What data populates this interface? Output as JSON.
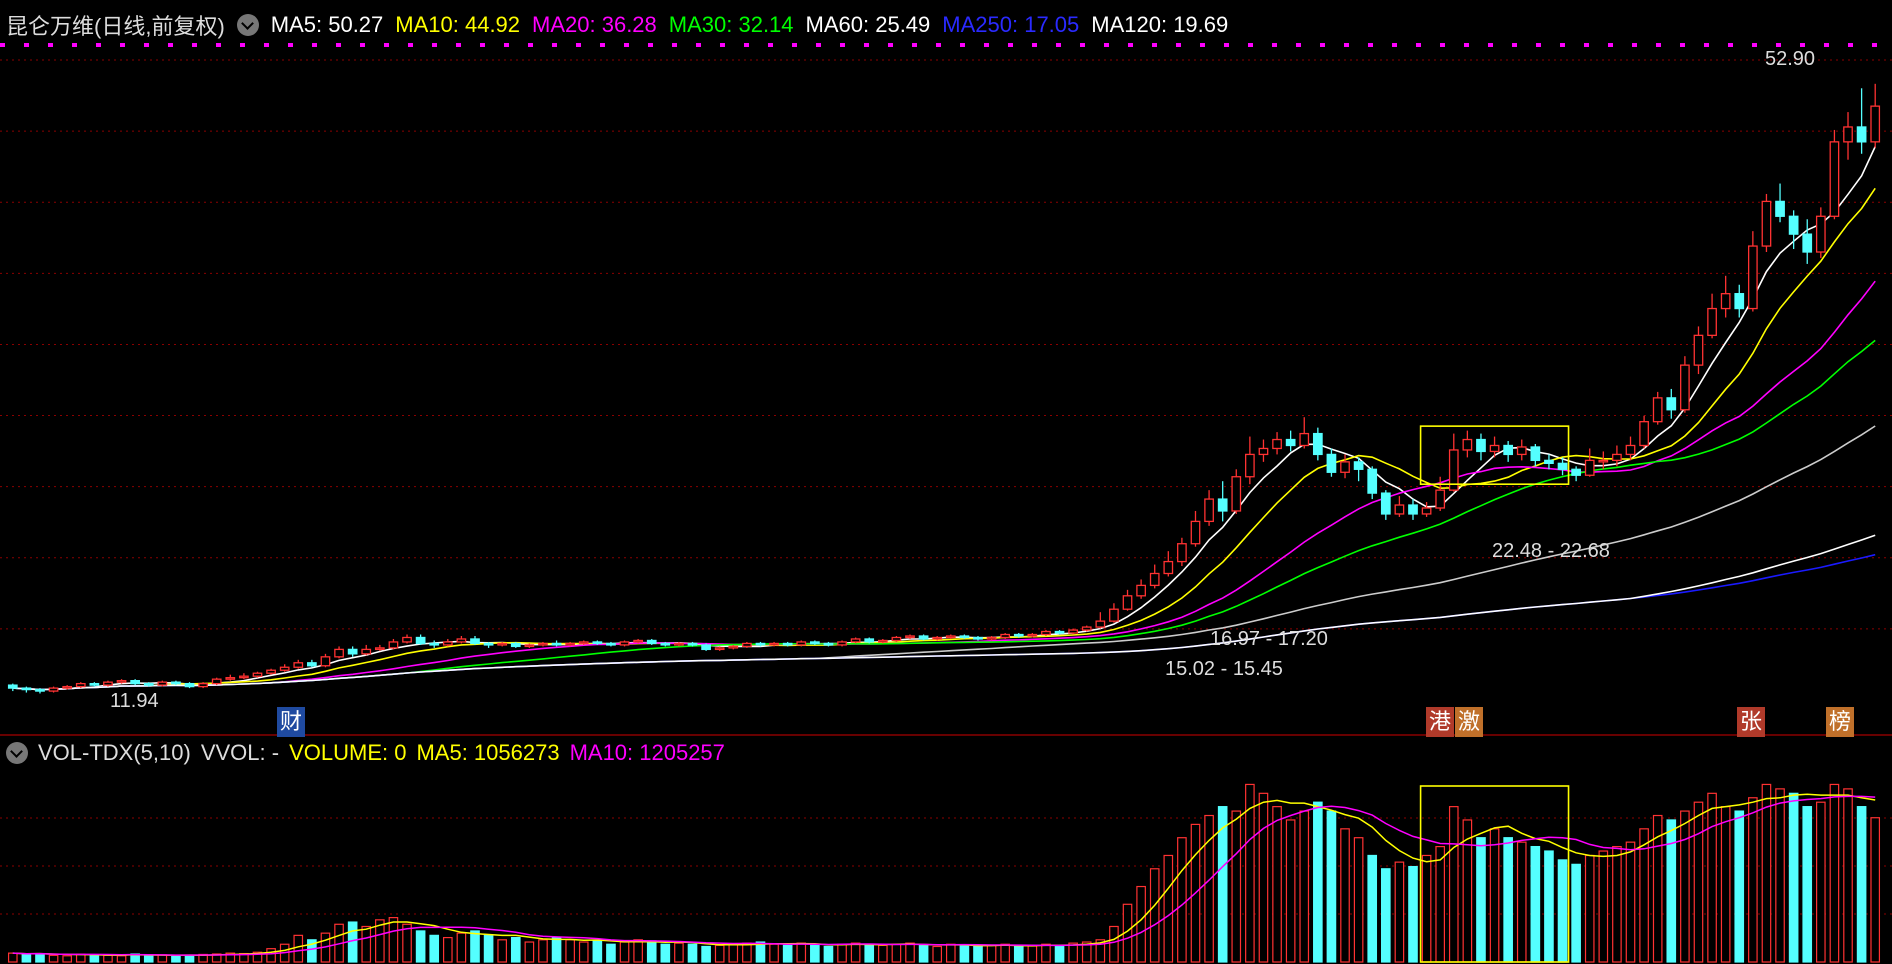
{
  "header": {
    "stock_name": "昆仑万维(日线,前复权)",
    "ma": [
      {
        "label": "MA5: 50.27",
        "color": "#ffffff"
      },
      {
        "label": "MA10: 44.92",
        "color": "#ffff00"
      },
      {
        "label": "MA20: 36.28",
        "color": "#ff00ff"
      },
      {
        "label": "MA30: 32.14",
        "color": "#00ff00"
      },
      {
        "label": "MA60: 25.49",
        "color": "#ffffff"
      },
      {
        "label": "MA250: 17.05",
        "color": "#2020ff"
      },
      {
        "label": "MA120: 19.69",
        "color": "#ffffff"
      }
    ]
  },
  "volume_header": {
    "indicator": "VOL-TDX(5,10)",
    "vvol": "VVOL: -",
    "volume": "VOLUME: 0",
    "ma5": "MA5: 1056273",
    "ma10": "MA10: 1205257"
  },
  "price_labels": {
    "high": "52.90",
    "low": "11.94",
    "range1": "16.97 - 17.20",
    "range2": "15.02 - 15.45",
    "range3": "22.48 - 22.68"
  },
  "events": [
    {
      "label": "财",
      "color": "#1f4aa0"
    },
    {
      "label": "港",
      "color": "#b03a2a"
    },
    {
      "label": "激",
      "color": "#c0702a"
    },
    {
      "label": "张",
      "color": "#b03a2a"
    },
    {
      "label": "榜",
      "color": "#c0702a"
    }
  ],
  "colors": {
    "up": "#ff3232",
    "down": "#54ffff",
    "background": "#000000",
    "grid": "#8b0000",
    "box": "#ffff00"
  },
  "chart_data": {
    "type": "candlestick",
    "title": "昆仑万维(日线,前复权)",
    "ylim": [
      11.5,
      54.5
    ],
    "candles": [
      [
        12.5,
        12.3,
        12.6,
        12.1
      ],
      [
        12.3,
        12.2,
        12.4,
        12.0
      ],
      [
        12.2,
        12.1,
        12.3,
        11.94
      ],
      [
        12.1,
        12.3,
        12.4,
        12.0
      ],
      [
        12.3,
        12.4,
        12.5,
        12.2
      ],
      [
        12.4,
        12.6,
        12.7,
        12.3
      ],
      [
        12.6,
        12.5,
        12.7,
        12.4
      ],
      [
        12.5,
        12.7,
        12.8,
        12.4
      ],
      [
        12.7,
        12.8,
        12.9,
        12.6
      ],
      [
        12.8,
        12.6,
        12.9,
        12.5
      ],
      [
        12.6,
        12.5,
        12.7,
        12.4
      ],
      [
        12.5,
        12.7,
        12.8,
        12.4
      ],
      [
        12.7,
        12.6,
        12.8,
        12.5
      ],
      [
        12.6,
        12.4,
        12.7,
        12.3
      ],
      [
        12.4,
        12.6,
        12.7,
        12.3
      ],
      [
        12.6,
        12.9,
        13.0,
        12.5
      ],
      [
        12.9,
        13.0,
        13.2,
        12.8
      ],
      [
        13.0,
        13.1,
        13.3,
        12.9
      ],
      [
        13.1,
        13.3,
        13.4,
        13.0
      ],
      [
        13.3,
        13.5,
        13.6,
        13.2
      ],
      [
        13.5,
        13.7,
        13.9,
        13.4
      ],
      [
        13.7,
        14.0,
        14.2,
        13.6
      ],
      [
        14.0,
        13.8,
        14.2,
        13.7
      ],
      [
        13.8,
        14.4,
        14.6,
        13.7
      ],
      [
        14.4,
        14.9,
        15.1,
        14.3
      ],
      [
        14.9,
        14.6,
        15.1,
        14.4
      ],
      [
        14.6,
        14.9,
        15.2,
        14.5
      ],
      [
        14.9,
        15.0,
        15.2,
        14.8
      ],
      [
        15.0,
        15.4,
        15.6,
        14.9
      ],
      [
        15.4,
        15.7,
        15.9,
        15.3
      ],
      [
        15.7,
        15.3,
        15.9,
        15.2
      ],
      [
        15.3,
        15.2,
        15.5,
        15.0
      ],
      [
        15.2,
        15.4,
        15.6,
        15.1
      ],
      [
        15.4,
        15.6,
        15.8,
        15.3
      ],
      [
        15.6,
        15.3,
        15.8,
        15.2
      ],
      [
        15.3,
        15.2,
        15.4,
        15.0
      ],
      [
        15.2,
        15.3,
        15.4,
        15.1
      ],
      [
        15.3,
        15.1,
        15.4,
        15.0
      ],
      [
        15.1,
        15.2,
        15.3,
        15.0
      ],
      [
        15.2,
        15.3,
        15.4,
        15.1
      ],
      [
        15.3,
        15.2,
        15.5,
        15.1
      ],
      [
        15.2,
        15.3,
        15.4,
        15.1
      ],
      [
        15.3,
        15.4,
        15.5,
        15.2
      ],
      [
        15.4,
        15.3,
        15.5,
        15.2
      ],
      [
        15.3,
        15.2,
        15.4,
        15.1
      ],
      [
        15.2,
        15.4,
        15.5,
        15.1
      ],
      [
        15.4,
        15.5,
        15.6,
        15.3
      ],
      [
        15.5,
        15.3,
        15.6,
        15.2
      ],
      [
        15.3,
        15.2,
        15.4,
        15.1
      ],
      [
        15.2,
        15.3,
        15.4,
        15.1
      ],
      [
        15.3,
        15.2,
        15.4,
        15.1
      ],
      [
        15.2,
        14.9,
        15.3,
        14.8
      ],
      [
        14.9,
        15.0,
        15.1,
        14.8
      ],
      [
        15.0,
        15.1,
        15.2,
        14.9
      ],
      [
        15.1,
        15.3,
        15.4,
        15.0
      ],
      [
        15.3,
        15.2,
        15.4,
        15.1
      ],
      [
        15.2,
        15.3,
        15.4,
        15.1
      ],
      [
        15.3,
        15.2,
        15.4,
        15.1
      ],
      [
        15.2,
        15.4,
        15.5,
        15.1
      ],
      [
        15.4,
        15.3,
        15.5,
        15.2
      ],
      [
        15.3,
        15.2,
        15.4,
        15.1
      ],
      [
        15.2,
        15.4,
        15.5,
        15.1
      ],
      [
        15.4,
        15.6,
        15.7,
        15.3
      ],
      [
        15.6,
        15.4,
        15.7,
        15.3
      ],
      [
        15.4,
        15.5,
        15.6,
        15.3
      ],
      [
        15.5,
        15.7,
        15.8,
        15.4
      ],
      [
        15.7,
        15.8,
        15.9,
        15.6
      ],
      [
        15.8,
        15.6,
        15.9,
        15.5
      ],
      [
        15.6,
        15.7,
        15.8,
        15.5
      ],
      [
        15.7,
        15.8,
        15.9,
        15.6
      ],
      [
        15.8,
        15.7,
        15.9,
        15.6
      ],
      [
        15.7,
        15.6,
        15.8,
        15.5
      ],
      [
        15.6,
        15.7,
        15.8,
        15.5
      ],
      [
        15.7,
        15.9,
        16.0,
        15.6
      ],
      [
        15.9,
        15.8,
        16.0,
        15.7
      ],
      [
        15.8,
        15.9,
        16.0,
        15.7
      ],
      [
        15.9,
        16.1,
        16.2,
        15.8
      ],
      [
        16.1,
        16.0,
        16.2,
        15.9
      ],
      [
        16.0,
        16.2,
        16.3,
        15.9
      ],
      [
        16.2,
        16.4,
        16.5,
        16.1
      ],
      [
        16.4,
        16.8,
        17.4,
        16.3
      ],
      [
        16.8,
        17.6,
        18.0,
        16.7
      ],
      [
        17.6,
        18.5,
        18.9,
        17.5
      ],
      [
        18.5,
        19.2,
        19.6,
        18.3
      ],
      [
        19.2,
        20.0,
        20.6,
        19.0
      ],
      [
        20.0,
        20.8,
        21.5,
        19.8
      ],
      [
        20.8,
        22.0,
        22.4,
        20.5
      ],
      [
        22.0,
        23.5,
        24.2,
        21.8
      ],
      [
        23.5,
        25.0,
        25.6,
        23.2
      ],
      [
        25.0,
        24.2,
        26.2,
        23.5
      ],
      [
        24.2,
        26.5,
        27.0,
        24.0
      ],
      [
        26.5,
        28.0,
        29.2,
        26.0
      ],
      [
        28.0,
        28.4,
        29.0,
        27.5
      ],
      [
        28.4,
        29.0,
        29.5,
        28.0
      ],
      [
        29.0,
        28.6,
        29.6,
        28.2
      ],
      [
        28.6,
        29.4,
        30.5,
        28.4
      ],
      [
        29.4,
        28.0,
        29.8,
        27.6
      ],
      [
        28.0,
        26.8,
        28.4,
        26.5
      ],
      [
        26.8,
        27.5,
        28.0,
        26.4
      ],
      [
        27.5,
        27.0,
        27.8,
        26.2
      ],
      [
        27.0,
        25.4,
        27.2,
        25.0
      ],
      [
        25.4,
        24.0,
        25.6,
        23.6
      ],
      [
        24.0,
        24.6,
        25.2,
        23.8
      ],
      [
        24.6,
        24.0,
        25.0,
        23.6
      ],
      [
        24.0,
        24.4,
        24.8,
        23.8
      ],
      [
        24.4,
        25.6,
        26.5,
        24.2
      ],
      [
        25.6,
        28.3,
        29.4,
        25.5
      ],
      [
        28.3,
        29.0,
        29.6,
        27.8
      ],
      [
        29.0,
        28.2,
        29.4,
        27.6
      ],
      [
        28.2,
        28.6,
        29.2,
        27.8
      ],
      [
        28.6,
        28.0,
        28.9,
        27.5
      ],
      [
        28.0,
        28.5,
        29.0,
        27.6
      ],
      [
        28.5,
        27.6,
        28.7,
        27.2
      ],
      [
        27.6,
        27.4,
        28.0,
        27.0
      ],
      [
        27.4,
        27.0,
        27.8,
        26.6
      ],
      [
        27.0,
        26.6,
        27.2,
        26.2
      ],
      [
        26.6,
        27.6,
        28.4,
        26.5
      ],
      [
        27.6,
        27.6,
        28.2,
        27.0
      ],
      [
        27.6,
        28.0,
        28.6,
        27.2
      ],
      [
        28.0,
        28.6,
        29.2,
        27.6
      ],
      [
        28.6,
        30.2,
        30.6,
        28.4
      ],
      [
        30.2,
        31.8,
        32.2,
        30.0
      ],
      [
        31.8,
        31.0,
        32.4,
        30.4
      ],
      [
        31.0,
        34.0,
        34.6,
        30.8
      ],
      [
        34.0,
        36.0,
        36.6,
        33.4
      ],
      [
        36.0,
        37.8,
        38.8,
        35.8
      ],
      [
        37.8,
        38.8,
        40.0,
        37.2
      ],
      [
        38.8,
        37.8,
        39.4,
        37.2
      ],
      [
        37.8,
        42.0,
        43.0,
        37.6
      ],
      [
        42.0,
        45.0,
        45.5,
        41.6
      ],
      [
        45.0,
        44.0,
        46.2,
        43.6
      ],
      [
        44.0,
        42.8,
        44.4,
        41.8
      ],
      [
        42.8,
        41.6,
        43.8,
        40.8
      ],
      [
        41.6,
        44.0,
        44.6,
        41.2
      ],
      [
        44.0,
        49.0,
        49.8,
        43.8
      ],
      [
        49.0,
        50.0,
        51.0,
        47.8
      ],
      [
        50.0,
        49.0,
        52.6,
        48.2
      ],
      [
        49.0,
        51.4,
        52.9,
        48.6
      ]
    ],
    "volumes_k": [
      [
        40,
        0
      ],
      [
        35,
        1
      ],
      [
        38,
        1
      ],
      [
        30,
        0
      ],
      [
        28,
        0
      ],
      [
        35,
        0
      ],
      [
        33,
        1
      ],
      [
        30,
        0
      ],
      [
        28,
        0
      ],
      [
        36,
        1
      ],
      [
        30,
        1
      ],
      [
        32,
        0
      ],
      [
        28,
        1
      ],
      [
        30,
        1
      ],
      [
        34,
        0
      ],
      [
        36,
        0
      ],
      [
        40,
        0
      ],
      [
        38,
        0
      ],
      [
        44,
        0
      ],
      [
        60,
        0
      ],
      [
        80,
        0
      ],
      [
        120,
        0
      ],
      [
        100,
        1
      ],
      [
        130,
        0
      ],
      [
        170,
        0
      ],
      [
        180,
        1
      ],
      [
        160,
        0
      ],
      [
        190,
        0
      ],
      [
        200,
        0
      ],
      [
        170,
        0
      ],
      [
        140,
        1
      ],
      [
        120,
        1
      ],
      [
        110,
        0
      ],
      [
        130,
        0
      ],
      [
        140,
        1
      ],
      [
        120,
        1
      ],
      [
        100,
        0
      ],
      [
        110,
        1
      ],
      [
        90,
        0
      ],
      [
        100,
        0
      ],
      [
        110,
        1
      ],
      [
        100,
        0
      ],
      [
        90,
        0
      ],
      [
        95,
        1
      ],
      [
        80,
        1
      ],
      [
        90,
        0
      ],
      [
        100,
        0
      ],
      [
        95,
        1
      ],
      [
        80,
        1
      ],
      [
        85,
        0
      ],
      [
        80,
        1
      ],
      [
        70,
        1
      ],
      [
        75,
        0
      ],
      [
        80,
        0
      ],
      [
        85,
        0
      ],
      [
        90,
        1
      ],
      [
        80,
        0
      ],
      [
        75,
        1
      ],
      [
        85,
        0
      ],
      [
        80,
        1
      ],
      [
        70,
        1
      ],
      [
        80,
        0
      ],
      [
        85,
        0
      ],
      [
        80,
        1
      ],
      [
        75,
        0
      ],
      [
        80,
        0
      ],
      [
        85,
        0
      ],
      [
        75,
        1
      ],
      [
        70,
        0
      ],
      [
        80,
        0
      ],
      [
        75,
        1
      ],
      [
        70,
        1
      ],
      [
        75,
        0
      ],
      [
        80,
        0
      ],
      [
        70,
        1
      ],
      [
        72,
        0
      ],
      [
        80,
        0
      ],
      [
        75,
        1
      ],
      [
        85,
        0
      ],
      [
        90,
        0
      ],
      [
        100,
        0
      ],
      [
        160,
        0
      ],
      [
        260,
        0
      ],
      [
        340,
        0
      ],
      [
        420,
        0
      ],
      [
        480,
        0
      ],
      [
        560,
        0
      ],
      [
        620,
        0
      ],
      [
        660,
        0
      ],
      [
        700,
        1
      ],
      [
        680,
        0
      ],
      [
        800,
        0
      ],
      [
        760,
        0
      ],
      [
        700,
        0
      ],
      [
        640,
        0
      ],
      [
        680,
        0
      ],
      [
        720,
        1
      ],
      [
        680,
        1
      ],
      [
        600,
        0
      ],
      [
        560,
        0
      ],
      [
        480,
        1
      ],
      [
        420,
        1
      ],
      [
        450,
        0
      ],
      [
        430,
        1
      ],
      [
        480,
        0
      ],
      [
        520,
        0
      ],
      [
        700,
        0
      ],
      [
        640,
        0
      ],
      [
        560,
        1
      ],
      [
        600,
        0
      ],
      [
        560,
        1
      ],
      [
        540,
        0
      ],
      [
        520,
        1
      ],
      [
        500,
        1
      ],
      [
        460,
        1
      ],
      [
        440,
        1
      ],
      [
        480,
        0
      ],
      [
        500,
        0
      ],
      [
        520,
        0
      ],
      [
        540,
        0
      ],
      [
        600,
        0
      ],
      [
        660,
        0
      ],
      [
        640,
        1
      ],
      [
        680,
        0
      ],
      [
        720,
        0
      ],
      [
        760,
        0
      ],
      [
        700,
        0
      ],
      [
        680,
        1
      ],
      [
        740,
        0
      ],
      [
        800,
        0
      ],
      [
        780,
        0
      ],
      [
        760,
        1
      ],
      [
        700,
        1
      ],
      [
        720,
        0
      ],
      [
        800,
        0
      ],
      [
        780,
        0
      ],
      [
        700,
        1
      ],
      [
        650,
        0
      ]
    ],
    "ma_lines": [
      "MA5",
      "MA10",
      "MA20",
      "MA30",
      "MA60",
      "MA250",
      "MA120"
    ]
  }
}
